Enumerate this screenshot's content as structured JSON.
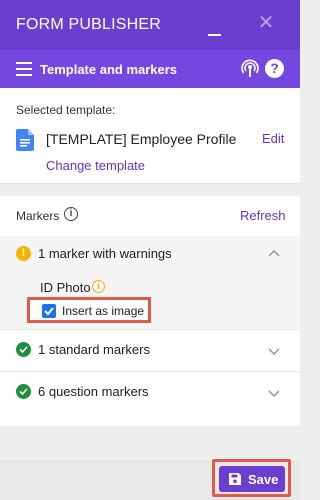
{
  "window": {
    "title": "FORM PUBLISHER",
    "minimize_glyph": "_",
    "close_glyph": "✕"
  },
  "header": {
    "title": "Template and markers",
    "icons": [
      "menu-icon",
      "podcast-icon",
      "help-icon"
    ],
    "help_glyph": "?"
  },
  "template": {
    "selected_label": "Selected template:",
    "name": "[TEMPLATE] Employee Profile",
    "edit_label": "Edit",
    "change_label": "Change template"
  },
  "markers": {
    "label": "Markers",
    "info_glyph": "i",
    "refresh_label": "Refresh",
    "warnings": {
      "title": "1 marker with warnings",
      "expanded": true,
      "field_name": "ID Photo",
      "checkbox_label": "Insert as image",
      "checkbox_checked": true
    },
    "groups": [
      {
        "label": "1 standard markers",
        "expanded": false
      },
      {
        "label": "6 question markers",
        "expanded": false
      }
    ]
  },
  "footer": {
    "save_label": "Save"
  },
  "colors": {
    "brand_dark": "#6a3fd0",
    "brand": "#7447e0",
    "link": "#5a37c8",
    "warning": "#f4b400",
    "success": "#1e8e3e",
    "highlight": "#e05a4a",
    "checkbox": "#1a73e8"
  }
}
